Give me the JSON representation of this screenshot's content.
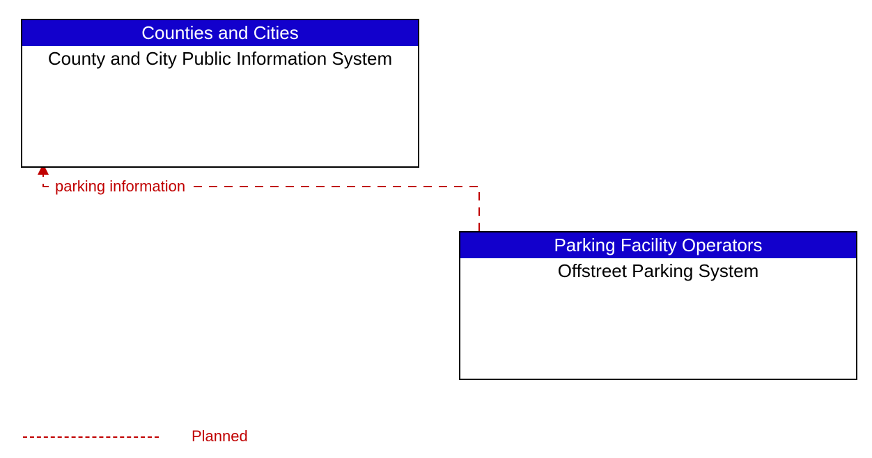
{
  "boxes": {
    "left": {
      "header": "Counties and Cities",
      "body": "County and City Public Information System"
    },
    "right": {
      "header": "Parking Facility Operators",
      "body": "Offstreet Parking System"
    }
  },
  "flow_label": "parking information",
  "legend": {
    "text": "Planned"
  },
  "colors": {
    "header_bg": "#1200cc",
    "flow": "#c00000"
  }
}
